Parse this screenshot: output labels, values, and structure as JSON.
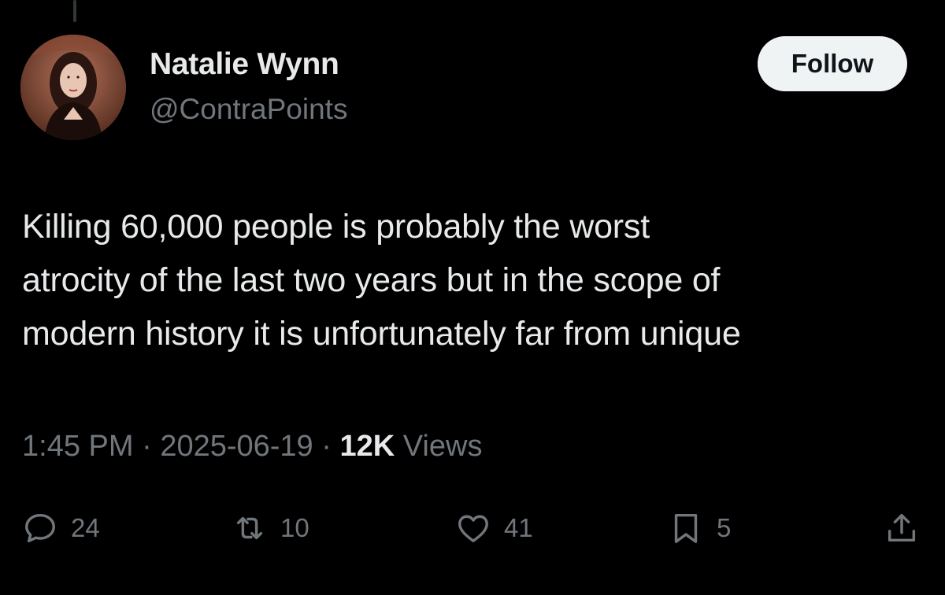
{
  "tweet": {
    "author": {
      "display_name": "Natalie Wynn",
      "handle": "@ContraPoints"
    },
    "follow_label": "Follow",
    "text": "Killing 60,000 people is probably the worst\natrocity of the last two years but in the scope of\nmodern history it is unfortunately far from unique",
    "time": "1:45 PM",
    "date": "2025-06-19",
    "separator": "·",
    "views_count": "12K",
    "views_label": "Views",
    "stats": {
      "replies": "24",
      "reposts": "10",
      "likes": "41",
      "bookmarks": "5"
    }
  },
  "icons": {
    "reply": "reply-icon",
    "repost": "repost-icon",
    "like": "heart-icon",
    "bookmark": "bookmark-icon",
    "share": "share-icon"
  },
  "colors": {
    "background": "#000000",
    "text_primary": "#e7e9ea",
    "text_secondary": "#71767b",
    "follow_button_bg": "#eff3f4",
    "follow_button_text": "#0f1419"
  }
}
